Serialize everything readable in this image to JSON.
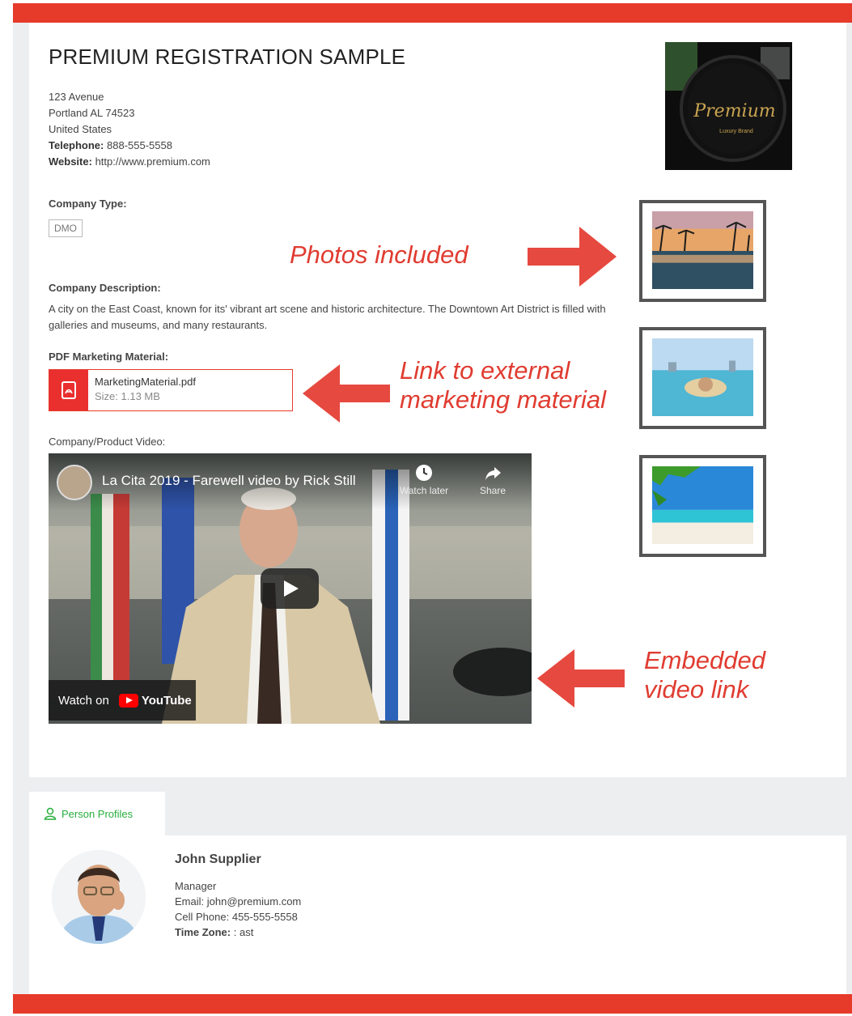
{
  "company": {
    "title": "PREMIUM REGISTRATION SAMPLE",
    "address_line1": "123 Avenue",
    "address_line2": "Portland AL 74523",
    "country": "United States",
    "telephone_label": "Telephone:",
    "telephone": "888-555-5558",
    "website_label": "Website:",
    "website": "http://www.premium.com",
    "logo_text": "Premium",
    "logo_subtext": "Luxury Brand"
  },
  "company_type": {
    "label": "Company Type:",
    "value": "DMO"
  },
  "description": {
    "label": "Company Description:",
    "text": "A city on the East Coast, known for its' vibrant art scene and historic architecture. The Downtown Art District is filled with galleries and museums, and many restaurants."
  },
  "pdf": {
    "label": "PDF Marketing Material:",
    "file_name": "MarketingMaterial.pdf",
    "size_label": "Size: 1.13 MB"
  },
  "video": {
    "label": "Company/Product Video:",
    "title": "La Cita 2019 - Farewell video by Rick Still",
    "watch_later": "Watch later",
    "share": "Share",
    "watch_on": "Watch on",
    "youtube": "YouTube"
  },
  "annotations": {
    "photos": "Photos included",
    "link_line1": "Link to external",
    "link_line2": "marketing material",
    "video_line1": "Embedded",
    "video_line2": "video link"
  },
  "colors": {
    "brand_red": "#e63a2a",
    "annotation_red": "#e03c31",
    "tab_green": "#27ae3c"
  },
  "profiles": {
    "tab_label": "Person Profiles",
    "person": {
      "name": "John Supplier",
      "role": "Manager",
      "email_label": "Email:",
      "email": "john@premium.com",
      "phone_label": "Cell Phone:",
      "phone": "455-555-5558",
      "timezone_label": "Time Zone:",
      "timezone": ": ast"
    }
  }
}
